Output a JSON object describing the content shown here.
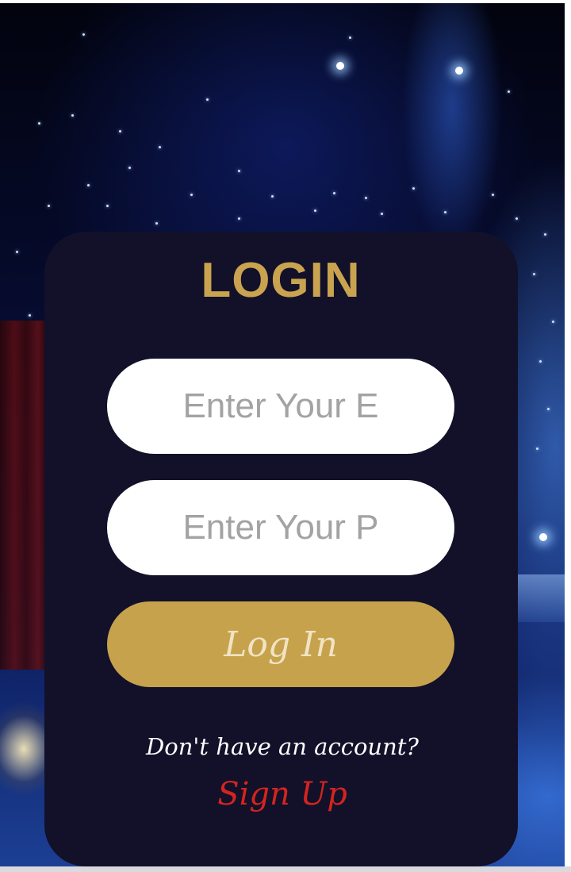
{
  "login": {
    "title": "LOGIN",
    "email_placeholder": "Enter Your E",
    "password_placeholder": "Enter Your P",
    "login_button_label": "Log In",
    "no_account_text": "Don't have an account?",
    "signup_link_label": "Sign Up"
  },
  "colors": {
    "card_background": "#121129",
    "accent_gold": "#c9a34f",
    "button_gold": "#c6a24c",
    "signup_red": "#d4241f",
    "field_background": "#ffffff"
  }
}
